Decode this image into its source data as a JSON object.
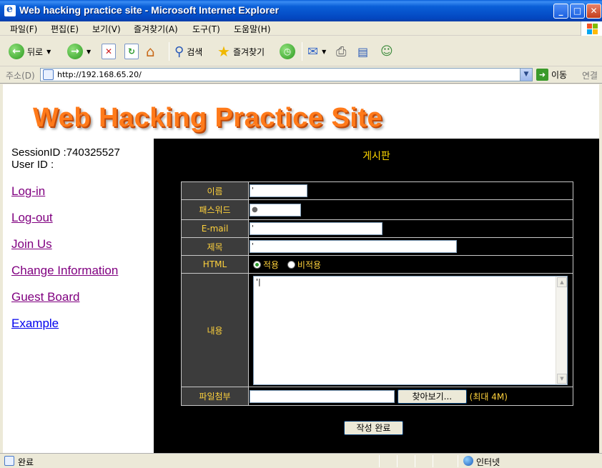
{
  "window": {
    "title": "Web hacking practice site - Microsoft Internet Explorer"
  },
  "menu": [
    "파일(F)",
    "편집(E)",
    "보기(V)",
    "즐겨찾기(A)",
    "도구(T)",
    "도움말(H)"
  ],
  "toolbar": {
    "back_label": "뒤로",
    "search_label": "검색",
    "favorites_label": "즐겨찾기"
  },
  "address": {
    "label": "주소(D)",
    "url": "http://192.168.65.20/",
    "go_label": "이동",
    "links_label": "연결"
  },
  "site": {
    "logo_text": "Web Hacking Practice Site",
    "session_id": "SessionID :740325527",
    "user_id": "User ID :",
    "nav": [
      "Log-in",
      "Log-out",
      "Join Us",
      "Change Information",
      "Guest Board",
      "Example"
    ]
  },
  "board": {
    "title": "게시판",
    "labels": {
      "name": "이름",
      "password": "패스워드",
      "email": "E-mail",
      "subject": "제목",
      "html": "HTML",
      "content": "내용",
      "attach": "파일첨부"
    },
    "values": {
      "name": "'",
      "password": "●",
      "email": "'",
      "subject": "'",
      "content": "'|"
    },
    "html_options": [
      "적용",
      "비적용"
    ],
    "browse_label": "찾아보기...",
    "max_size": "(최대 4M)",
    "submit_label": "작성 완료"
  },
  "status": {
    "text": "완료",
    "zone": "인터넷"
  }
}
